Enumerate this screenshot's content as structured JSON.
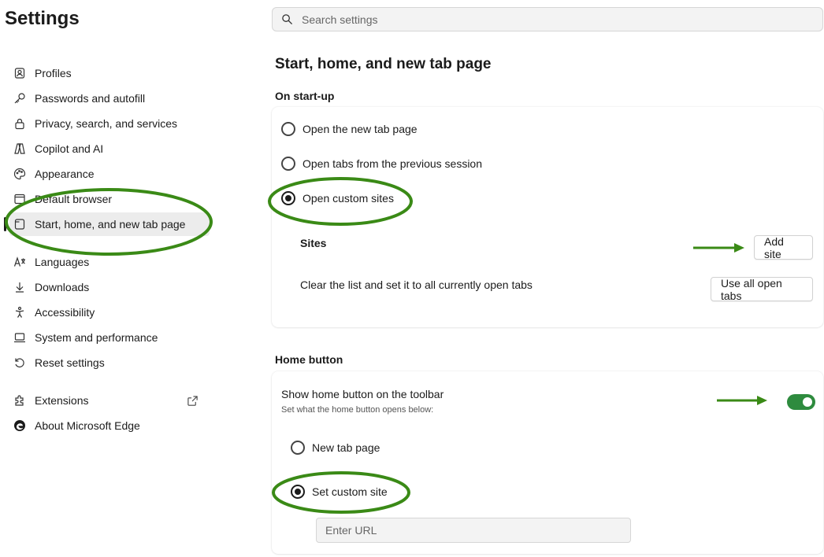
{
  "header": {
    "title": "Settings"
  },
  "search": {
    "placeholder": "Search settings",
    "icon": "search-icon"
  },
  "sidebar": {
    "items": [
      {
        "label": "Profiles",
        "icon": "profile-icon"
      },
      {
        "label": "Passwords and autofill",
        "icon": "key-icon"
      },
      {
        "label": "Privacy, search, and services",
        "icon": "lock-icon"
      },
      {
        "label": "Copilot and AI",
        "icon": "copilot-icon"
      },
      {
        "label": "Appearance",
        "icon": "palette-icon"
      },
      {
        "label": "Default browser",
        "icon": "browser-icon"
      },
      {
        "label": "Start, home, and new tab page",
        "icon": "home-page-icon",
        "active": true
      },
      {
        "label": "Languages",
        "icon": "languages-icon"
      },
      {
        "label": "Downloads",
        "icon": "download-icon"
      },
      {
        "label": "Accessibility",
        "icon": "accessibility-icon"
      },
      {
        "label": "System and performance",
        "icon": "laptop-icon"
      },
      {
        "label": "Reset settings",
        "icon": "reset-icon"
      }
    ],
    "extensions": {
      "label": "Extensions",
      "icon": "puzzle-icon",
      "external_icon": "external-link-icon"
    },
    "about": {
      "label": "About Microsoft Edge",
      "icon": "edge-logo-icon"
    }
  },
  "main": {
    "page_title": "Start, home, and new tab page",
    "startup": {
      "heading": "On start-up",
      "options": [
        {
          "label": "Open the new tab page",
          "checked": false
        },
        {
          "label": "Open tabs from the previous session",
          "checked": false
        },
        {
          "label": "Open custom sites",
          "checked": true
        }
      ],
      "sites_label": "Sites",
      "add_site_button": "Add site",
      "clear_text": "Clear the list and set it to all currently open tabs",
      "use_open_tabs_button": "Use all open tabs"
    },
    "home_button": {
      "heading": "Home button",
      "show_label": "Show home button on the toolbar",
      "show_description": "Set what the home button opens below:",
      "toggle_on": true,
      "options": [
        {
          "label": "New tab page",
          "checked": false
        },
        {
          "label": "Set custom site",
          "checked": true
        }
      ],
      "url_placeholder": "Enter URL"
    }
  },
  "colors": {
    "annotation": "#3a8a16",
    "toggle_on": "#2e8b3e",
    "active_bg": "#ececec"
  }
}
